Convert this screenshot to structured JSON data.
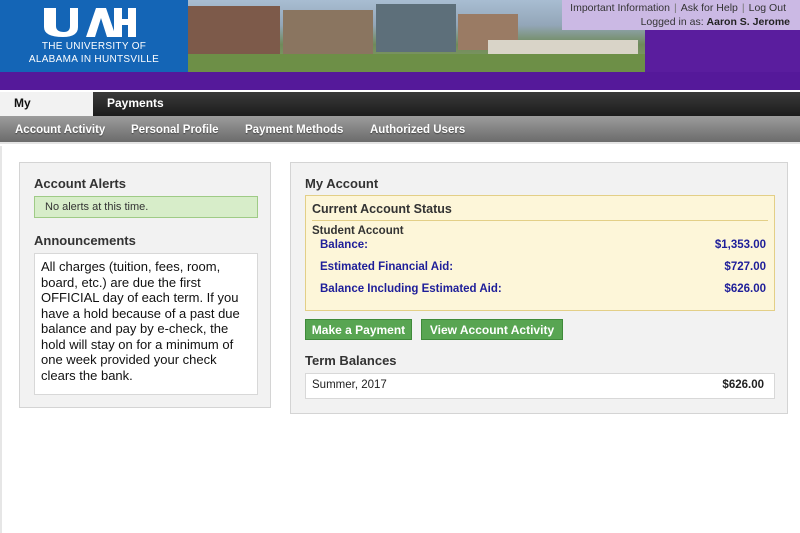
{
  "header": {
    "logo_line1": "THE UNIVERSITY OF",
    "logo_line2": "ALABAMA IN HUNTSVILLE",
    "top_links": [
      "Important Information",
      "Ask for Help",
      "Log Out"
    ],
    "logged_in_label": "Logged in as:",
    "user_name": "Aaron S. Jerome"
  },
  "nav": {
    "primary_tabs": [
      "My Account",
      "Payments"
    ],
    "active_tab": "My Account",
    "secondary_links": [
      "Account Activity",
      "Personal Profile",
      "Payment Methods",
      "Authorized Users"
    ]
  },
  "left_panel": {
    "alerts_title": "Account Alerts",
    "alerts_message": "No alerts at this time.",
    "announcements_title": "Announcements",
    "announcement_text": "All charges (tuition, fees, room, board, etc.) are due the first OFFICIAL day of each term. If you have a hold because of a past due balance and pay by e-check, the hold will stay on for a minimum of one week provided your check clears the bank."
  },
  "my_account": {
    "title": "My Account",
    "status_title": "Current Account Status",
    "student_account_label": "Student Account",
    "rows": [
      {
        "label": "Balance:",
        "value": "$1,353.00"
      },
      {
        "label": "Estimated Financial Aid:",
        "value": "$727.00"
      },
      {
        "label": "Balance Including Estimated Aid:",
        "value": "$626.00"
      }
    ],
    "make_payment_label": "Make a Payment",
    "view_activity_label": "View Account Activity",
    "term_balances_title": "Term Balances",
    "term_balances": [
      {
        "term": "Summer, 2017",
        "amount": "$626.00"
      }
    ]
  },
  "colors": {
    "header_purple": "#55199a",
    "logo_blue": "#1465b6",
    "button_green": "#58a552",
    "label_blue": "#1e1e99",
    "alert_green": "#d7edc9",
    "status_yellow": "#fdf6d9"
  }
}
